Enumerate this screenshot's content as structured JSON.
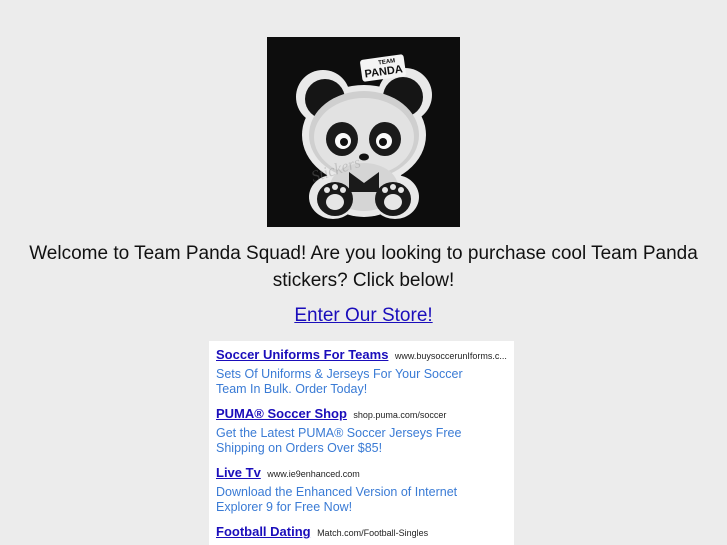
{
  "logo": {
    "alt_text_top": "TEAM",
    "alt_text_main": "PANDA",
    "watermark": "Stickers"
  },
  "welcome": {
    "line1": "Welcome to Team Panda Squad! Are you looking to purchase cool Team Panda",
    "line2": "stickers? Click below!"
  },
  "store_link": {
    "label": "Enter Our Store!"
  },
  "ads": [
    {
      "title": "Soccer Uniforms For Teams",
      "url": "www.buysoccerunIforms.c...",
      "desc": "Sets Of Uniforms & Jerseys For Your Soccer Team In Bulk. Order Today!"
    },
    {
      "title": "PUMA® Soccer Shop",
      "url": "shop.puma.com/soccer",
      "desc": "Get the Latest PUMA® Soccer Jerseys Free Shipping on Orders Over $85!"
    },
    {
      "title": "Live Tv",
      "url": "www.ie9enhanced.com",
      "desc": "Download the Enhanced Version of Internet Explorer 9 for Free Now!"
    },
    {
      "title": "Football Dating",
      "url": "Match.com/Football-Singles",
      "desc": ""
    }
  ]
}
